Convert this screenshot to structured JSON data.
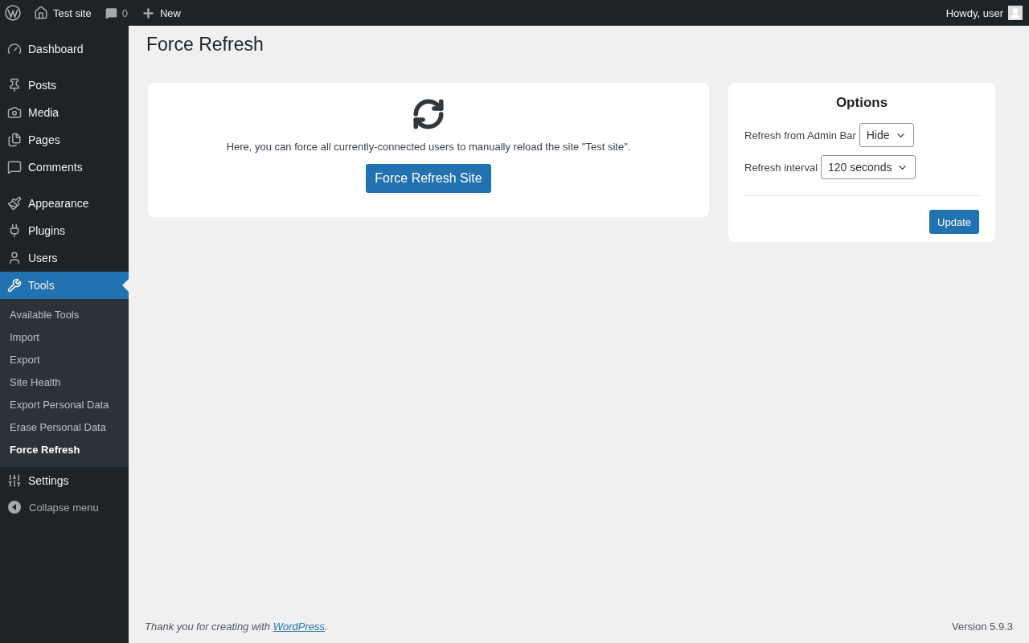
{
  "admin_bar": {
    "site_name": "Test site",
    "comments_count": "0",
    "new_label": "New",
    "greeting": "Howdy, user"
  },
  "sidebar": {
    "menu_groups": [
      [
        {
          "label": "Dashboard",
          "selected": false
        }
      ],
      [
        {
          "label": "Posts",
          "selected": false
        },
        {
          "label": "Media",
          "selected": false
        },
        {
          "label": "Pages",
          "selected": false
        },
        {
          "label": "Comments",
          "selected": false
        }
      ],
      [
        {
          "label": "Appearance",
          "selected": false
        },
        {
          "label": "Plugins",
          "selected": false
        },
        {
          "label": "Users",
          "selected": false
        },
        {
          "label": "Tools",
          "selected": true,
          "submenu": [
            {
              "label": "Available Tools",
              "selected": false
            },
            {
              "label": "Import",
              "selected": false
            },
            {
              "label": "Export",
              "selected": false
            },
            {
              "label": "Site Health",
              "selected": false
            },
            {
              "label": "Export Personal Data",
              "selected": false
            },
            {
              "label": "Erase Personal Data",
              "selected": false
            },
            {
              "label": "Force Refresh",
              "selected": true
            }
          ]
        },
        {
          "label": "Settings",
          "selected": false
        }
      ]
    ],
    "collapse_label": "Collapse menu"
  },
  "page_title": "Force Refresh",
  "main_card": {
    "description": "Here, you can force all currently-connected users to manually reload the site \"Test site\".",
    "button": "Force Refresh Site"
  },
  "options": {
    "title": "Options",
    "fields": [
      {
        "label": "Refresh from Admin Bar",
        "value": "Hide"
      },
      {
        "label": "Refresh interval",
        "value": "120 seconds"
      }
    ],
    "button": "Update"
  },
  "footer": {
    "thanks_before": "Thank you for creating with ",
    "link": "WordPress",
    "thanks_after": ".",
    "version": "Version 5.9.3"
  }
}
